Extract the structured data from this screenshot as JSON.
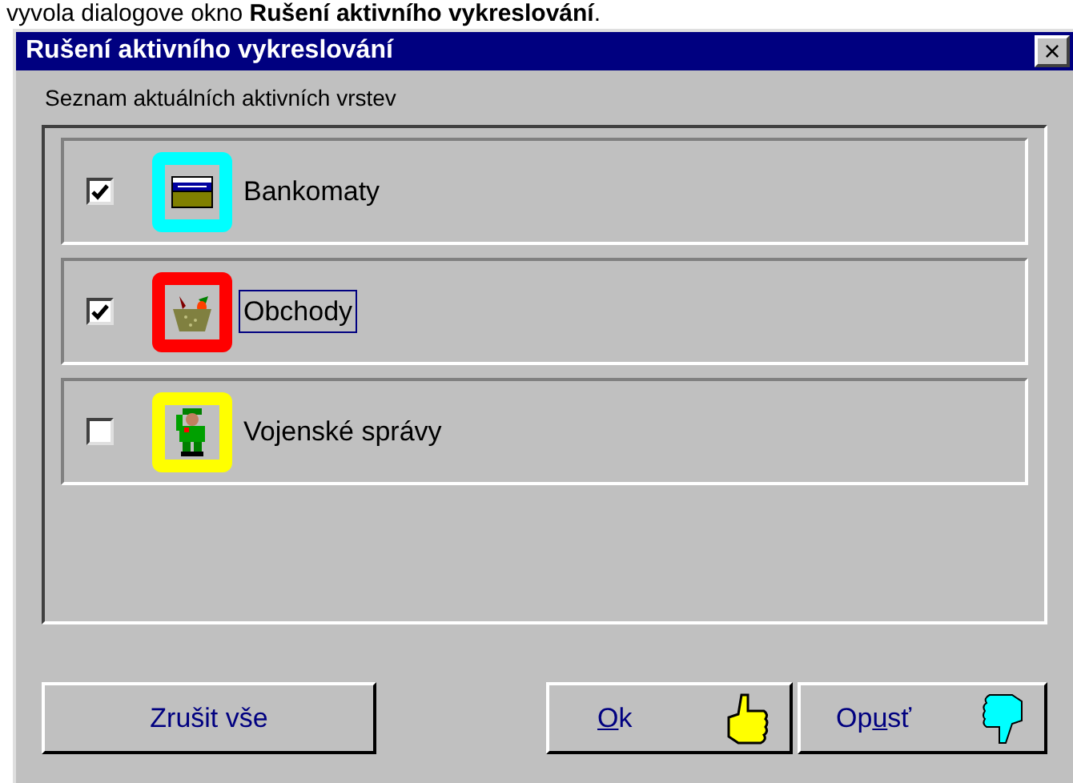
{
  "caption": {
    "prefix": "vyvola dialogove okno ",
    "bold": "Rušení aktivního vykreslování",
    "suffix": "."
  },
  "window": {
    "title": "Rušení aktivního vykreslování",
    "close": "×"
  },
  "list_label": "Seznam aktuálních aktivních vrstev",
  "layers": [
    {
      "name": "Bankomaty",
      "checked": true,
      "focused": false,
      "color": "#00ffff"
    },
    {
      "name": "Obchody",
      "checked": true,
      "focused": true,
      "color": "#ff0000"
    },
    {
      "name": "Vojenské správy",
      "checked": false,
      "focused": false,
      "color": "#ffff00"
    }
  ],
  "buttons": [
    {
      "kind": "plain",
      "label": "Zrušit vše"
    },
    {
      "kind": "accept",
      "mnemonic": "O",
      "after": "k"
    },
    {
      "kind": "reject",
      "before": "Op",
      "mnemonic": "u",
      "after": "sť"
    }
  ]
}
